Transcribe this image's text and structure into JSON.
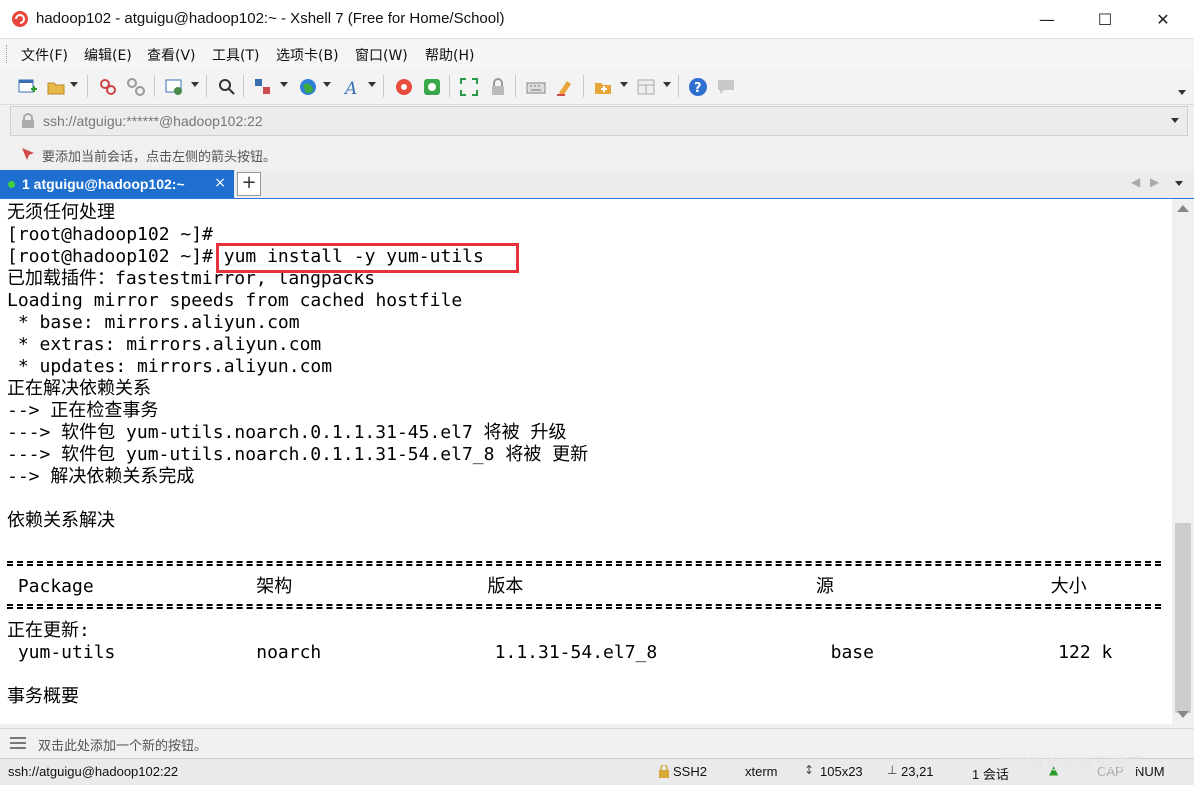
{
  "window": {
    "title": "hadoop102 - atguigu@hadoop102:~ - Xshell 7 (Free for Home/School)",
    "minimize_glyph": "—",
    "maximize_glyph": "☐",
    "close_glyph": "✕"
  },
  "menu": [
    "文件(F)",
    "编辑(E)",
    "查看(V)",
    "工具(T)",
    "选项卡(B)",
    "窗口(W)",
    "帮助(H)"
  ],
  "address": {
    "value": "ssh://atguigu:******@hadoop102:22"
  },
  "hint": "要添加当前会话，点击左侧的箭头按钮。",
  "tab": {
    "label": "1 atguigu@hadoop102:~",
    "close": "×",
    "add": "+"
  },
  "terminal": {
    "lines": [
      "无须任何处理",
      "[root@hadoop102 ~]#",
      "[root@hadoop102 ~]# yum install -y yum-utils",
      "已加载插件：fastestmirror, langpacks",
      "Loading mirror speeds from cached hostfile",
      " * base: mirrors.aliyun.com",
      " * extras: mirrors.aliyun.com",
      " * updates: mirrors.aliyun.com",
      "正在解决依赖关系",
      "--> 正在检查事务",
      "---> 软件包 yum-utils.noarch.0.1.1.31-45.el7 将被 升级",
      "---> 软件包 yum-utils.noarch.0.1.1.31-54.el7_8 将被 更新",
      "--> 解决依赖关系完成",
      "",
      "依赖关系解决",
      "",
      "",
      " Package               架构                  版本                           源                    大小",
      "",
      "正在更新:",
      " yum-utils             noarch                1.1.31-54.el7_8                base                 122 k",
      "",
      "事务概要"
    ],
    "highlighted_command": "yum install -y yum-utils"
  },
  "quickbar": {
    "text": "双击此处添加一个新的按钮。"
  },
  "status": {
    "connection": "ssh://atguigu@hadoop102:22",
    "protocol": "SSH2",
    "terminal_type": "xterm",
    "size": "105x23",
    "cursor": "23,21",
    "sessions": "1 会话",
    "cap": "CAP",
    "num": "NUM"
  },
  "watermark": "CSDN @最後 耻缘苦",
  "colors": {
    "tab_active": "#1f6fd0",
    "highlight_box": "#e8323b"
  }
}
